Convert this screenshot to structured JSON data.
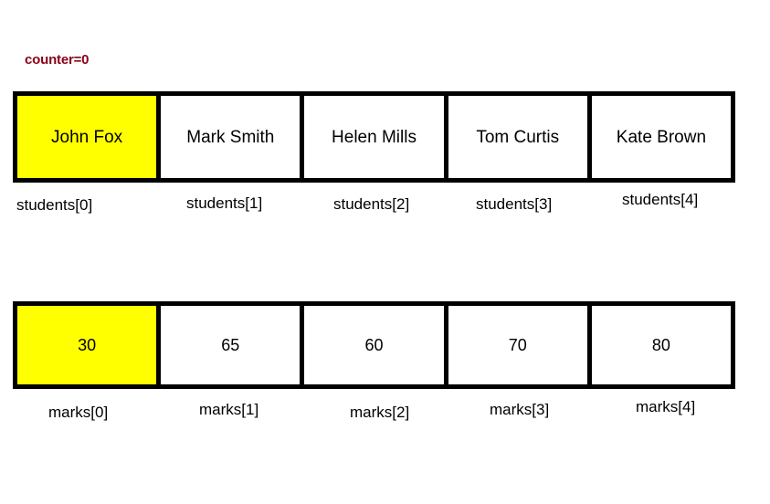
{
  "annotation": {
    "counter_text": "counter=0",
    "counter_color": "#8B0018"
  },
  "colors": {
    "highlight": "#FFFF00",
    "border": "#000000",
    "cell_background": "#FFFFFF"
  },
  "students_array": {
    "name": "students",
    "cells": [
      {
        "value": "John Fox",
        "label": "students[0]",
        "highlighted": true
      },
      {
        "value": "Mark Smith",
        "label": "students[1]",
        "highlighted": false
      },
      {
        "value": "Helen Mills",
        "label": "students[2]",
        "highlighted": false
      },
      {
        "value": "Tom Curtis",
        "label": "students[3]",
        "highlighted": false
      },
      {
        "value": "Kate Brown",
        "label": "students[4]",
        "highlighted": false
      }
    ]
  },
  "marks_array": {
    "name": "marks",
    "cells": [
      {
        "value": "30",
        "label": "marks[0]",
        "highlighted": true
      },
      {
        "value": "65",
        "label": "marks[1]",
        "highlighted": false
      },
      {
        "value": "60",
        "label": "marks[2]",
        "highlighted": false
      },
      {
        "value": "70",
        "label": "marks[3]",
        "highlighted": false
      },
      {
        "value": "80",
        "label": "marks[4]",
        "highlighted": false
      }
    ]
  }
}
